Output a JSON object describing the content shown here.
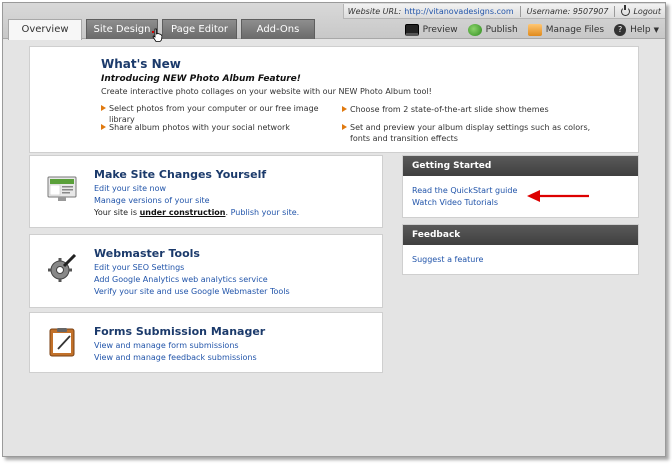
{
  "infobar": {
    "url_label": "Website URL:",
    "url_value": "http://vitanovadesigns.com",
    "username_label": "Username: 9507907",
    "logout": "Logout"
  },
  "tabs": [
    {
      "label": "Overview",
      "active": true
    },
    {
      "label": "Site Design",
      "active": false
    },
    {
      "label": "Page Editor",
      "active": false
    },
    {
      "label": "Add-Ons",
      "active": false
    }
  ],
  "toolbar": {
    "preview": "Preview",
    "publish": "Publish",
    "manage_files": "Manage Files",
    "help": "Help"
  },
  "whats_new": {
    "title": "What's New",
    "subtitle": "Introducing NEW Photo Album Feature!",
    "description": "Create interactive photo collages on your website with our NEW Photo Album tool!",
    "bullets": [
      "Select photos from your computer or our free image library",
      "Share album photos with your social network",
      "Choose from 2 state-of-the-art slide show themes",
      "Set and preview your album display settings such as colors, fonts and transition effects"
    ]
  },
  "make_changes": {
    "title": "Make Site Changes Yourself",
    "edit_link": "Edit your site now",
    "versions_link": "Manage versions of your site",
    "status_prefix": "Your site is",
    "status_value": "under construction",
    "status_suffix": ".",
    "publish_link": "Publish your site."
  },
  "webmaster": {
    "title": "Webmaster Tools",
    "links": [
      "Edit your SEO Settings",
      "Add Google Analytics web analytics service",
      "Verify your site and use Google Webmaster Tools"
    ]
  },
  "forms": {
    "title": "Forms Submission Manager",
    "links": [
      "View and manage form submissions",
      "View and manage feedback submissions"
    ]
  },
  "getting_started": {
    "header": "Getting Started",
    "links": [
      "Read the QuickStart guide",
      "Watch Video Tutorials"
    ]
  },
  "feedback": {
    "header": "Feedback",
    "link": "Suggest a feature"
  },
  "colors": {
    "link": "#2255aa",
    "title": "#1b3a6b",
    "bullet": "#e07a10",
    "arrow": "#dd0000"
  }
}
